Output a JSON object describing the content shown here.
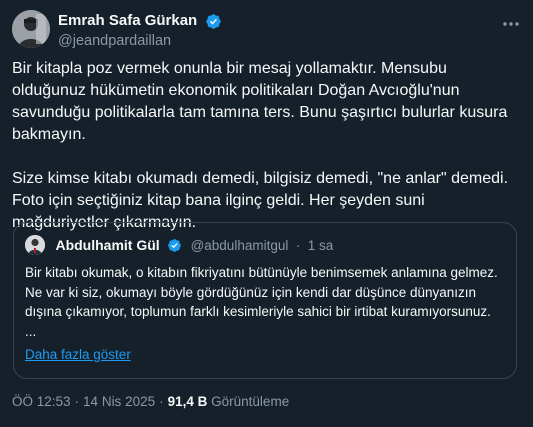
{
  "author": {
    "name": "Emrah Safa Gürkan",
    "handle": "@jeandpardaillan",
    "verified_color": "#1d9bf0"
  },
  "tweet": {
    "paragraphs": [
      "Bir kitapla poz vermek onunla bir mesaj yollamaktır. Mensubu olduğunuz hükümetin ekonomik politikaları Doğan Avcıoğlu'nun savunduğu politikalarla tam tamına ters. Bunu şaşırtıcı bulurlar kusura bakmayın.",
      "Size kimse kitabı okumadı demedi, bilgisiz demedi, \"ne anlar\" demedi. Foto için seçtiğiniz kitap bana ilginç geldi. Her şeyden suni mağduriyetler çıkarmayın."
    ]
  },
  "quote": {
    "name": "Abdulhamit Gül",
    "handle": "@abdulhamitgul",
    "dot": "·",
    "time": "1 sa",
    "text": "Bir kitabı okumak, o kitabın fikriyatını bütünüyle benimsemek anlamına gelmez. Ne var ki siz, okumayı böyle gördüğünüz için kendi dar düşünce dünyanızın dışına çıkamıyor, toplumun farklı kesimleriyle sahici bir irtibat kuramıyorsunuz.",
    "ellipsis": "...",
    "show_more": "Daha fazla göster"
  },
  "meta": {
    "time": "ÖÖ 12:53",
    "separator": "·",
    "date": "14 Nis 2025",
    "views_count": "91,4 B",
    "views_label": "Görüntüleme"
  },
  "icons": {
    "more": "more-horizontal-icon",
    "verified": "verified-badge-icon"
  }
}
